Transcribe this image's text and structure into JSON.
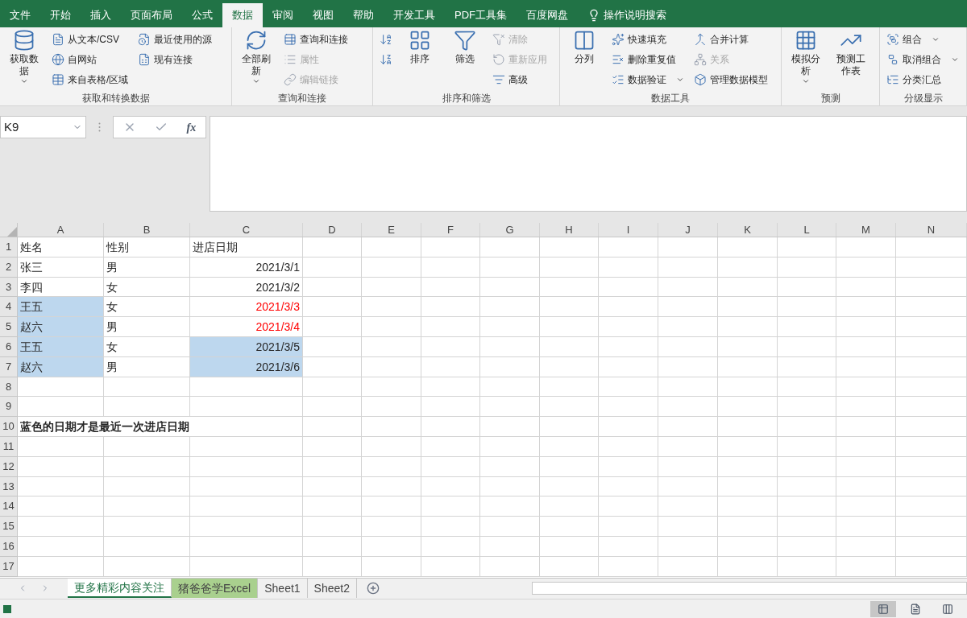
{
  "ribbon_tabs": [
    {
      "label": "文件",
      "selected": false
    },
    {
      "label": "开始",
      "selected": false
    },
    {
      "label": "插入",
      "selected": false
    },
    {
      "label": "页面布局",
      "selected": false
    },
    {
      "label": "公式",
      "selected": false
    },
    {
      "label": "数据",
      "selected": true
    },
    {
      "label": "审阅",
      "selected": false
    },
    {
      "label": "视图",
      "selected": false
    },
    {
      "label": "帮助",
      "selected": false
    },
    {
      "label": "开发工具",
      "selected": false
    },
    {
      "label": "PDF工具集",
      "selected": false
    },
    {
      "label": "百度网盘",
      "selected": false
    }
  ],
  "tell_me": "操作说明搜索",
  "ribbon_groups": [
    {
      "label": "获取和转换数据",
      "columns": [
        {
          "kind": "large",
          "items": [
            {
              "label": "获取数据",
              "disabled": false,
              "menu": true
            }
          ]
        },
        {
          "kind": "stack",
          "items": [
            {
              "label": "从文本/CSV",
              "disabled": false,
              "menu": false
            },
            {
              "label": "自网站",
              "disabled": false,
              "menu": false
            },
            {
              "label": "来自表格/区域",
              "disabled": false,
              "menu": false
            }
          ]
        },
        {
          "kind": "stack",
          "items": [
            {
              "label": "最近使用的源",
              "disabled": false,
              "menu": false
            },
            {
              "label": "现有连接",
              "disabled": false,
              "menu": false
            }
          ]
        }
      ]
    },
    {
      "label": "查询和连接",
      "columns": [
        {
          "kind": "large",
          "items": [
            {
              "label": "全部刷新",
              "disabled": false,
              "menu": true
            }
          ]
        },
        {
          "kind": "stack",
          "items": [
            {
              "label": "查询和连接",
              "disabled": false,
              "menu": false
            },
            {
              "label": "属性",
              "disabled": true,
              "menu": false
            },
            {
              "label": "编辑链接",
              "disabled": true,
              "menu": false
            }
          ]
        }
      ]
    },
    {
      "label": "排序和筛选",
      "columns": [
        {
          "kind": "stack",
          "items": [
            {
              "disabled": false,
              "menu": false
            },
            {
              "disabled": false,
              "menu": false
            }
          ]
        },
        {
          "kind": "large",
          "items": [
            {
              "label": "排序",
              "disabled": false,
              "menu": false
            }
          ]
        },
        {
          "kind": "large",
          "items": [
            {
              "label": "筛选",
              "disabled": false,
              "menu": false
            }
          ]
        },
        {
          "kind": "stack",
          "items": [
            {
              "label": "清除",
              "disabled": true,
              "menu": false
            },
            {
              "label": "重新应用",
              "disabled": true,
              "menu": false
            },
            {
              "label": "高级",
              "disabled": false,
              "menu": false
            }
          ]
        }
      ]
    },
    {
      "label": "数据工具",
      "columns": [
        {
          "kind": "large",
          "items": [
            {
              "label": "分列",
              "disabled": false,
              "menu": false
            }
          ]
        },
        {
          "kind": "stack",
          "items": [
            {
              "label": "快速填充",
              "disabled": false,
              "menu": false
            },
            {
              "label": "删除重复值",
              "disabled": false,
              "menu": false
            },
            {
              "label": "数据验证",
              "disabled": false,
              "menu": true
            }
          ]
        },
        {
          "kind": "stack",
          "items": [
            {
              "label": "合并计算",
              "disabled": false,
              "menu": false
            },
            {
              "label": "关系",
              "disabled": true,
              "menu": false
            },
            {
              "label": "管理数据模型",
              "disabled": false,
              "menu": false
            }
          ]
        }
      ]
    },
    {
      "label": "预测",
      "columns": [
        {
          "kind": "large",
          "items": [
            {
              "label": "模拟分析",
              "disabled": false,
              "menu": true
            }
          ]
        },
        {
          "kind": "large",
          "items": [
            {
              "label": "预测工作表",
              "disabled": false,
              "menu": false
            }
          ]
        }
      ]
    },
    {
      "label": "分级显示",
      "columns": [
        {
          "kind": "stack",
          "items": [
            {
              "label": "组合",
              "disabled": false,
              "menu": true
            },
            {
              "label": "取消组合",
              "disabled": false,
              "menu": true
            },
            {
              "label": "分类汇总",
              "disabled": false,
              "menu": false
            }
          ]
        }
      ]
    }
  ],
  "name_box": "K9",
  "formula_function_label": "fx",
  "columns": [
    "A",
    "B",
    "C",
    "D",
    "E",
    "F",
    "G",
    "H",
    "I",
    "J",
    "K",
    "L",
    "M",
    "N"
  ],
  "rows": [
    {
      "number": "1",
      "cells": [
        {
          "text": "姓名",
          "kind": "text",
          "highlighted": false
        },
        {
          "text": "性别",
          "kind": "text",
          "highlighted": false
        },
        {
          "text": "进店日期",
          "kind": "text",
          "highlighted": false
        }
      ]
    },
    {
      "number": "2",
      "cells": [
        {
          "text": "张三",
          "kind": "text",
          "highlighted": false
        },
        {
          "text": "男",
          "kind": "text",
          "highlighted": false
        },
        {
          "text": "2021/3/1",
          "kind": "date",
          "highlighted": false
        }
      ]
    },
    {
      "number": "3",
      "cells": [
        {
          "text": "李四",
          "kind": "text",
          "highlighted": false
        },
        {
          "text": "女",
          "kind": "text",
          "highlighted": false
        },
        {
          "text": "2021/3/2",
          "kind": "date",
          "highlighted": false
        }
      ]
    },
    {
      "number": "4",
      "cells": [
        {
          "text": "王五",
          "kind": "text",
          "highlighted": true
        },
        {
          "text": "女",
          "kind": "text",
          "highlighted": false
        },
        {
          "text": "2021/3/3",
          "kind": "date",
          "highlighted": false,
          "color": "#ff0000"
        }
      ]
    },
    {
      "number": "5",
      "cells": [
        {
          "text": "赵六",
          "kind": "text",
          "highlighted": true
        },
        {
          "text": "男",
          "kind": "text",
          "highlighted": false
        },
        {
          "text": "2021/3/4",
          "kind": "date",
          "highlighted": false,
          "color": "#ff0000"
        }
      ]
    },
    {
      "number": "6",
      "cells": [
        {
          "text": "王五",
          "kind": "text",
          "highlighted": true
        },
        {
          "text": "女",
          "kind": "text",
          "highlighted": false
        },
        {
          "text": "2021/3/5",
          "kind": "date",
          "highlighted": true
        }
      ]
    },
    {
      "number": "7",
      "cells": [
        {
          "text": "赵六",
          "kind": "text",
          "highlighted": true
        },
        {
          "text": "男",
          "kind": "text",
          "highlighted": false
        },
        {
          "text": "2021/3/6",
          "kind": "date",
          "highlighted": true
        }
      ]
    },
    {
      "number": "8"
    },
    {
      "number": "9"
    },
    {
      "number": "10",
      "cells": [
        {
          "text": "蓝色的日期才是最近一次进店日期",
          "kind": "bold",
          "highlighted": false
        }
      ]
    },
    {
      "number": "11"
    },
    {
      "number": "12"
    },
    {
      "number": "13"
    },
    {
      "number": "14"
    },
    {
      "number": "15"
    },
    {
      "number": "16"
    },
    {
      "number": "17"
    }
  ],
  "sheet_tabs": [
    {
      "label": "更多精彩内容关注",
      "selected": true
    },
    {
      "label": "猪爸爸学Excel",
      "selected": false,
      "color": "#a9d08e"
    },
    {
      "label": "Sheet1",
      "selected": false
    },
    {
      "label": "Sheet2",
      "selected": false
    }
  ],
  "view_buttons": [
    {
      "selected": true
    },
    {
      "selected": false
    },
    {
      "selected": false
    }
  ]
}
